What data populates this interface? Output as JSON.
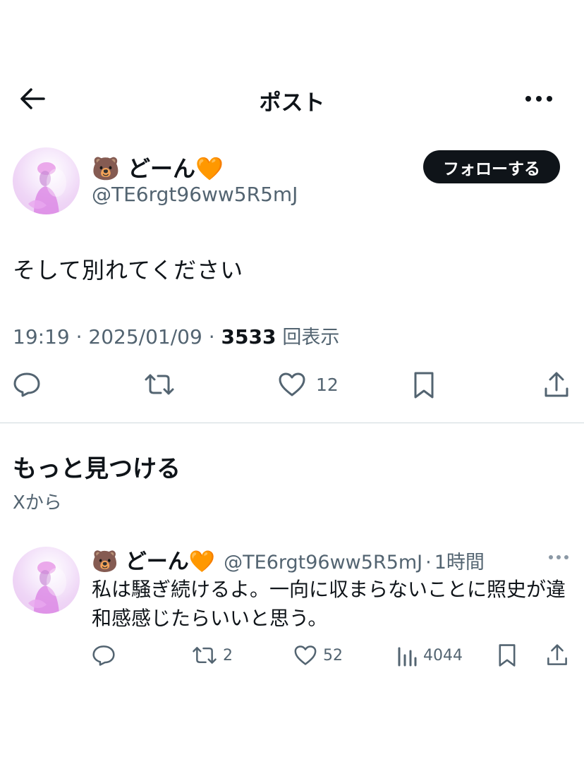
{
  "header": {
    "title": "ポスト",
    "back_icon": "arrow-left-icon",
    "more_icon": "more-horizontal-icon"
  },
  "tweet": {
    "author_name": "🐻 どーん🧡",
    "author_handle": "@TE6rgt96ww5R5mJ",
    "follow_label": "フォローする",
    "text": "そして別れてください",
    "time": "19:19",
    "date": "2025/01/09",
    "views": "3533",
    "views_label": "回表示",
    "likes": "12"
  },
  "discover": {
    "title": "もっと見つける",
    "subtitle": "Xから"
  },
  "related": {
    "author_name": "🐻 どーん🧡",
    "author_handle": "@TE6rgt96ww5R5mJ",
    "time": "1時間",
    "text": "私は騒ぎ続けるよ。一向に収まらないことに照史が違和感感じたらいいと思う。",
    "retweets": "2",
    "likes": "52",
    "views": "4044"
  },
  "colors": {
    "text": "#0f1419",
    "secondary": "#536471",
    "divider": "#cfd9de",
    "follow_bg": "#0f1419"
  }
}
